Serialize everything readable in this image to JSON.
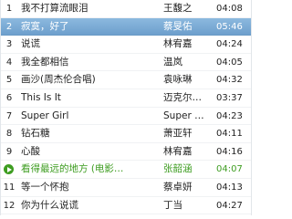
{
  "playlist": {
    "playing_color": "#3e9d21",
    "selected_color": "#7aaad6",
    "tracks": [
      {
        "num": "1",
        "title": "我不打算流眼泪",
        "artist": "王馥之",
        "time": "04:08",
        "state": "normal"
      },
      {
        "num": "2",
        "title": "寂寞，好了",
        "artist": "蔡旻佑",
        "time": "05:46",
        "state": "selected"
      },
      {
        "num": "3",
        "title": "说谎",
        "artist": "林宥嘉",
        "time": "04:24",
        "state": "normal"
      },
      {
        "num": "4",
        "title": "我全都相信",
        "artist": "温岚",
        "time": "04:05",
        "state": "normal"
      },
      {
        "num": "5",
        "title": "画沙(周杰伦合唱)",
        "artist": "袁咏琳",
        "time": "04:32",
        "state": "normal"
      },
      {
        "num": "6",
        "title": "This Is It",
        "artist": "迈克尔…",
        "time": "03:37",
        "state": "normal"
      },
      {
        "num": "7",
        "title": "Super Girl",
        "artist": "Super …",
        "time": "04:23",
        "state": "normal"
      },
      {
        "num": "8",
        "title": "钻石糖",
        "artist": "萧亚轩",
        "time": "04:11",
        "state": "normal"
      },
      {
        "num": "9",
        "title": "心酸",
        "artist": "林宥嘉",
        "time": "04:16",
        "state": "normal"
      },
      {
        "num": "10",
        "title": "看得最远的地方 (电影…",
        "artist": "张韶涵",
        "time": "04:07",
        "state": "playing"
      },
      {
        "num": "11",
        "title": "等一个怀抱",
        "artist": "蔡卓妍",
        "time": "04:13",
        "state": "normal"
      },
      {
        "num": "12",
        "title": "你为什么说谎",
        "artist": "丁当",
        "time": "04:27",
        "state": "normal"
      }
    ]
  }
}
